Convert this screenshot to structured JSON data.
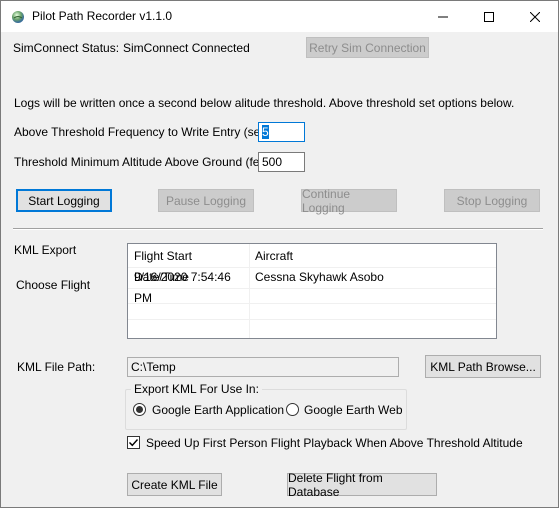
{
  "window": {
    "title": "Pilot Path Recorder v1.1.0",
    "controls": {
      "minimize": "minimize-icon",
      "maximize": "maximize-icon",
      "close": "close-icon"
    }
  },
  "simconnect": {
    "status_label": "SimConnect Status:",
    "status_value": "SimConnect Connected",
    "retry_button": "Retry Sim Connection"
  },
  "logging": {
    "info_text": "Logs will be written once a second below alitude threshold.  Above threshold set options below.",
    "frequency_label": "Above Threshold Frequency to Write Entry (secs):",
    "frequency_value": "5",
    "altitude_label": "Threshold Minimum Altitude Above Ground (feet):",
    "altitude_value": "500",
    "start_button": "Start Logging",
    "pause_button": "Pause Logging",
    "continue_button": "Continue Logging",
    "stop_button": "Stop Logging"
  },
  "kml": {
    "section_label": "KML Export",
    "choose_flight_label": "Choose Flight",
    "flights_table": {
      "columns": [
        "Flight Start Date/Time",
        "Aircraft"
      ],
      "rows": [
        {
          "start": "9/16/2020 7:54:46 PM",
          "aircraft": "Cessna Skyhawk Asobo"
        }
      ]
    },
    "file_path_label": "KML File Path:",
    "file_path_value": "C:\\Temp",
    "browse_button": "KML Path Browse...",
    "export_group_title": "Export KML For Use In:",
    "option_earth_app": "Google Earth Application",
    "option_earth_web": "Google Earth Web",
    "selected_option": "Google Earth Application",
    "speedup_label": "Speed Up First Person Flight Playback When Above Threshold Altitude",
    "speedup_checked": true,
    "create_button": "Create KML File",
    "delete_button": "Delete Flight from Database"
  },
  "colors": {
    "accent": "#0078d7",
    "window_bg": "#f0f0f0",
    "disabled_text": "#8d8d8d"
  }
}
